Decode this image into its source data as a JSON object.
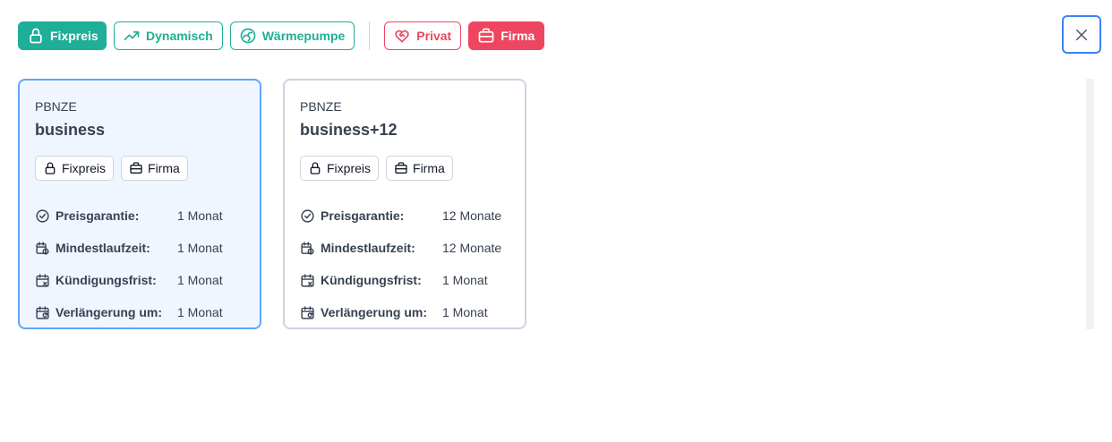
{
  "filters": {
    "fixpreis": "Fixpreis",
    "dynamisch": "Dynamisch",
    "waermepumpe": "Wärmepumpe",
    "privat": "Privat",
    "firma": "Firma"
  },
  "colors": {
    "teal": "#1fae97",
    "red": "#ee4660",
    "selected_border": "#60a5fa",
    "selected_bg": "#eff6ff"
  },
  "cards": [
    {
      "supplier": "PBNZE",
      "tariff": "business",
      "tags": [
        "Fixpreis",
        "Firma"
      ],
      "rows": [
        {
          "label": "Preisgarantie:",
          "value": "1 Monat"
        },
        {
          "label": "Mindestlaufzeit:",
          "value": "1 Monat"
        },
        {
          "label": "Kündigungsfrist:",
          "value": "1 Monat"
        },
        {
          "label": "Verlängerung um:",
          "value": "1 Monat"
        }
      ]
    },
    {
      "supplier": "PBNZE",
      "tariff": "business+12",
      "tags": [
        "Fixpreis",
        "Firma"
      ],
      "rows": [
        {
          "label": "Preisgarantie:",
          "value": "12 Monate"
        },
        {
          "label": "Mindestlaufzeit:",
          "value": "12 Monate"
        },
        {
          "label": "Kündigungsfrist:",
          "value": "1 Monat"
        },
        {
          "label": "Verlängerung um:",
          "value": "1 Monat"
        }
      ]
    }
  ]
}
